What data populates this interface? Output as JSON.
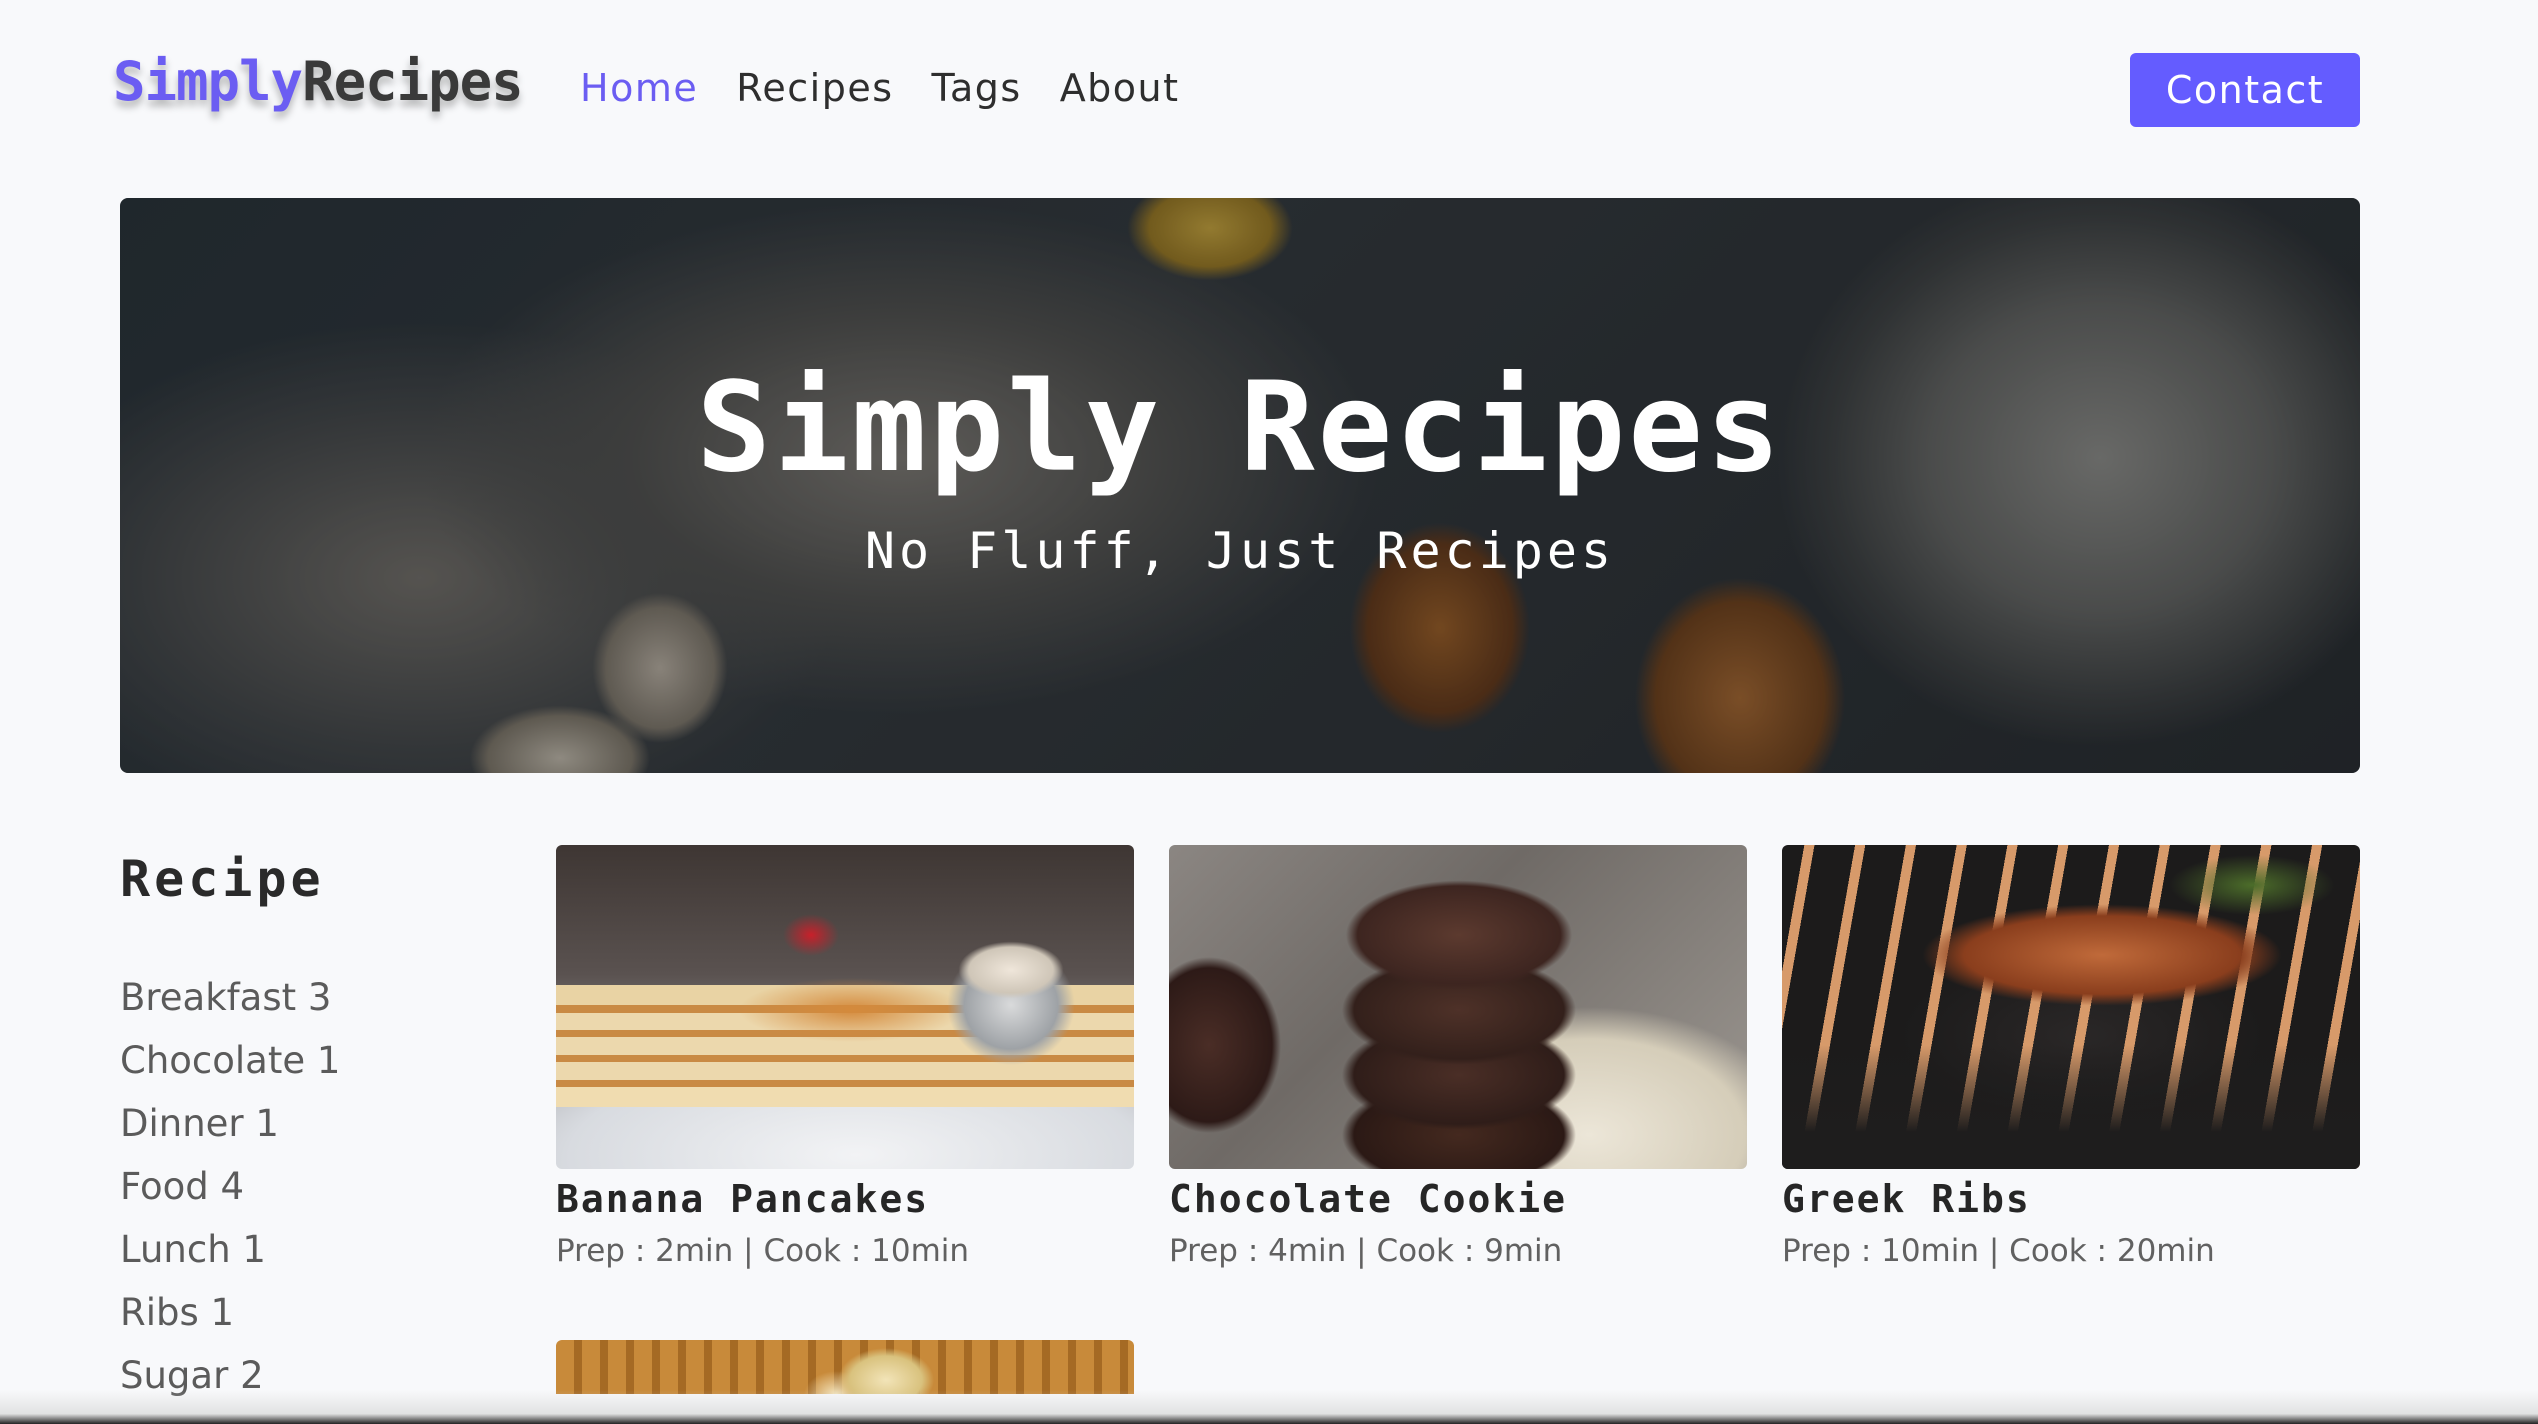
{
  "brand": {
    "accent": "Simply",
    "rest": "Recipes",
    "accent_color": "#6b5df2",
    "button_color": "#645cff"
  },
  "nav": {
    "links": [
      {
        "label": "Home",
        "active": true
      },
      {
        "label": "Recipes",
        "active": false
      },
      {
        "label": "Tags",
        "active": false
      },
      {
        "label": "About",
        "active": false
      }
    ],
    "contact_label": "Contact"
  },
  "hero": {
    "title": "Simply Recipes",
    "subtitle": "No Fluff, Just Recipes"
  },
  "sidebar": {
    "title": "Recipe",
    "tags": [
      {
        "label": "Breakfast 3"
      },
      {
        "label": "Chocolate 1"
      },
      {
        "label": "Dinner 1"
      },
      {
        "label": "Food 4"
      },
      {
        "label": "Lunch 1"
      },
      {
        "label": "Ribs 1"
      },
      {
        "label": "Sugar 2"
      }
    ]
  },
  "recipes": [
    {
      "title": "Banana Pancakes",
      "meta": "Prep : 2min | Cook : 10min",
      "image": "pancakes-photo"
    },
    {
      "title": "Chocolate Cookie",
      "meta": "Prep : 4min | Cook : 9min",
      "image": "cookie-photo"
    },
    {
      "title": "Greek Ribs",
      "meta": "Prep : 10min | Cook : 20min",
      "image": "ribs-photo"
    },
    {
      "title": "",
      "meta": "",
      "image": "waffle-photo"
    }
  ]
}
